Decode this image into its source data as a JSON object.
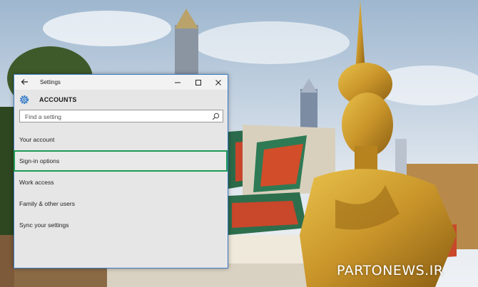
{
  "window": {
    "title": "Settings"
  },
  "header": {
    "title": "ACCOUNTS",
    "icon": "gear-icon"
  },
  "search": {
    "placeholder": "Find a setting"
  },
  "nav": {
    "items": [
      {
        "label": "Your account"
      },
      {
        "label": "Sign-in options"
      },
      {
        "label": "Work access"
      },
      {
        "label": "Family & other users"
      },
      {
        "label": "Sync your settings"
      }
    ],
    "selected_index": 1
  },
  "watermark": {
    "text": "PARTONEWS.IR"
  },
  "colors": {
    "accent": "#1e6fc6",
    "selection_border": "#1d9a54",
    "window_bg": "#e6e6e6"
  }
}
